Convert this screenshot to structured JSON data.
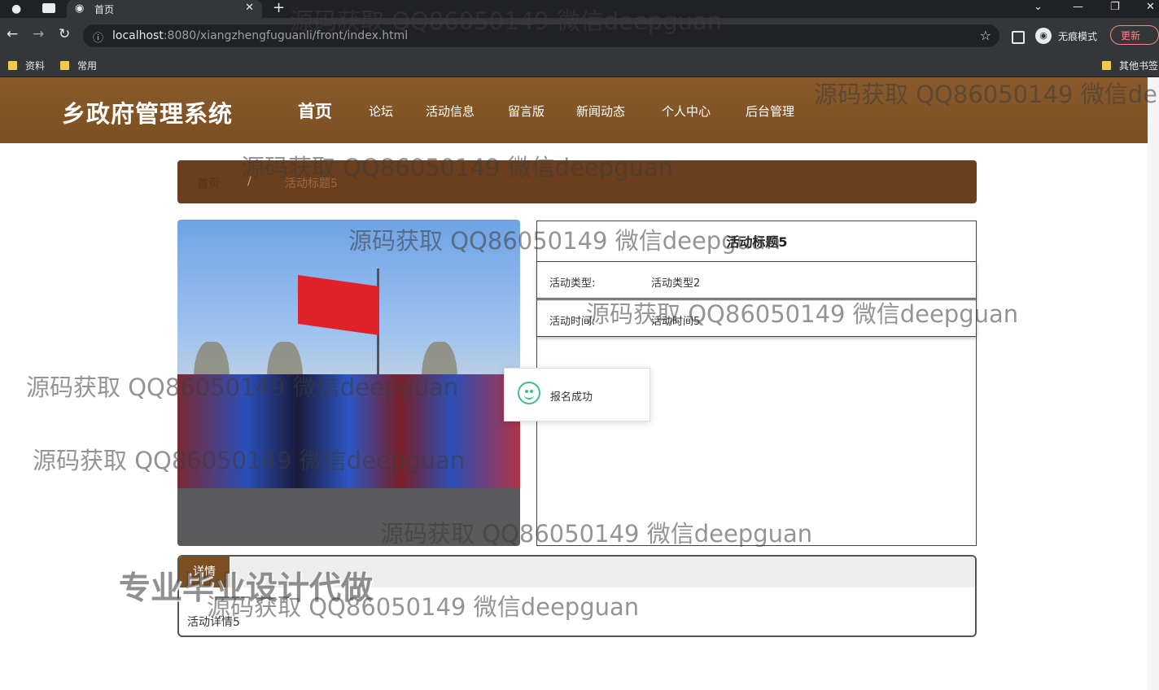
{
  "browser": {
    "tab_title": "首页",
    "url_host": "localhost",
    "url_rest": ":8080/xiangzhengfuguanli/front/index.html",
    "incognito_label": "无痕模式",
    "update_label": "更新",
    "bookmarks": [
      "资料",
      "常用"
    ],
    "other_bookmarks": "其他书签"
  },
  "site": {
    "logo": "乡政府管理系统",
    "nav": [
      "首页",
      "论坛",
      "活动信息",
      "留言版",
      "新闻动态",
      "个人中心",
      "后台管理"
    ],
    "breadcrumb": {
      "home": "首页",
      "sep": "/",
      "current": "活动标题5"
    }
  },
  "activity": {
    "title": "活动标题5",
    "type_label": "活动类型:",
    "type_value": "活动类型2",
    "time_label": "活动时间:",
    "time_value": "活动时间5"
  },
  "toast": {
    "message": "报名成功"
  },
  "detail": {
    "tab": "详情",
    "body": "活动详情5"
  },
  "watermark": {
    "text": "源码获取 QQ86050149 微信deepguan",
    "partial_header": "源码获取 QQ86050149 微信de",
    "partial_left1": "源码获取 QQ86050149 微信deepguan",
    "big": "专业毕业设计代做"
  },
  "colors": {
    "header": "#7b4f22",
    "breadcrumb": "#6b3f1e",
    "toast_icon": "#3cbf8a"
  }
}
